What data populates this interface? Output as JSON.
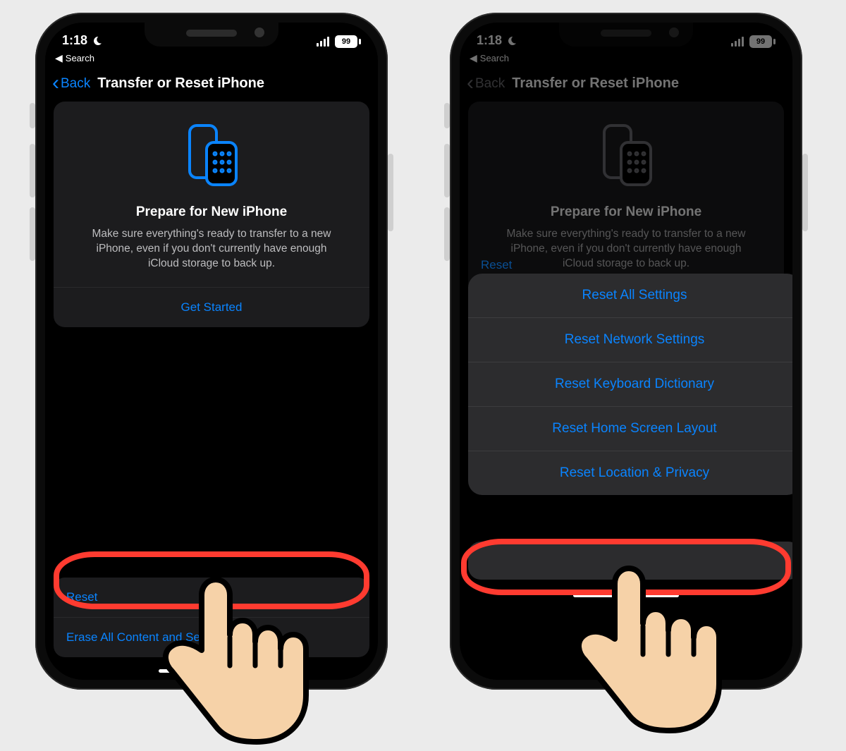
{
  "status": {
    "time": "1:18",
    "battery": "99",
    "back_to_app": "Search"
  },
  "nav": {
    "back_label": "Back",
    "title": "Transfer or Reset iPhone"
  },
  "prepare": {
    "heading": "Prepare for New iPhone",
    "body": "Make sure everything's ready to transfer to a new iPhone, even if you don't currently have enough iCloud storage to back up.",
    "cta": "Get Started"
  },
  "actions": {
    "reset": "Reset",
    "erase": "Erase All Content and Settings"
  },
  "reset_menu": {
    "items": [
      "Reset All Settings",
      "Reset Network Settings",
      "Reset Keyboard Dictionary",
      "Reset Home Screen Layout",
      "Reset Location & Privacy"
    ]
  }
}
